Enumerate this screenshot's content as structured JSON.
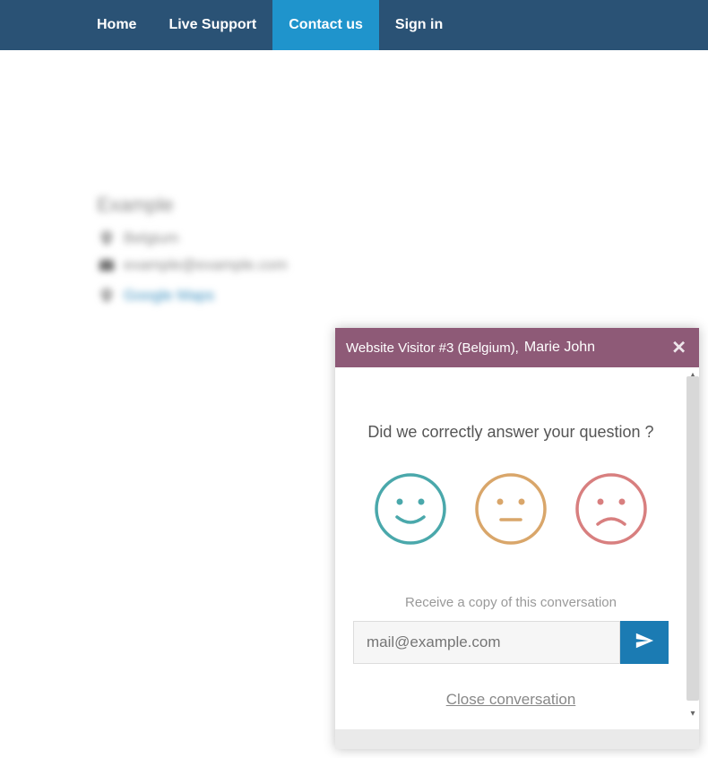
{
  "nav": {
    "home": "Home",
    "live_support": "Live Support",
    "contact_us": "Contact us",
    "sign_in": "Sign in"
  },
  "contact": {
    "heading": "Example",
    "location": "Belgium",
    "email": "example@example.com",
    "maps_link": "Google Maps"
  },
  "chat": {
    "visitor": "Website Visitor #3 (Belgium),",
    "agent": "Marie John",
    "survey_question": "Did we correctly answer your question ?",
    "faces": {
      "happy": "happy",
      "neutral": "neutral",
      "sad": "sad"
    },
    "copy_label": "Receive a copy of this conversation",
    "email_placeholder": "mail@example.com",
    "close_conversation": "Close conversation",
    "colors": {
      "happy": "#4aa8ab",
      "neutral": "#d9a66a",
      "sad": "#d87f7f"
    }
  }
}
